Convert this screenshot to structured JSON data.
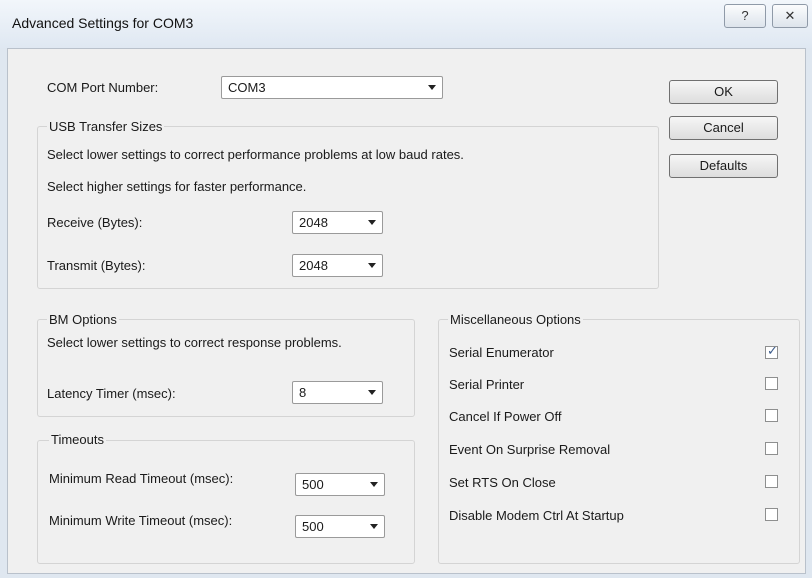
{
  "window": {
    "title": "Advanced Settings for COM3",
    "help_glyph": "?",
    "close_glyph": "✕"
  },
  "com_port": {
    "label": "COM Port Number:",
    "value": "COM3"
  },
  "usb": {
    "title": "USB Transfer Sizes",
    "desc1": "Select lower settings to correct performance problems at low baud rates.",
    "desc2": "Select higher settings for faster performance.",
    "receive_label": "Receive (Bytes):",
    "receive_value": "2048",
    "transmit_label": "Transmit (Bytes):",
    "transmit_value": "2048"
  },
  "bm": {
    "title": "BM Options",
    "desc": "Select lower settings to correct response problems.",
    "latency_label": "Latency Timer (msec):",
    "latency_value": "8"
  },
  "timeouts": {
    "title": "Timeouts",
    "read_label": "Minimum Read Timeout (msec):",
    "read_value": "500",
    "write_label": "Minimum Write Timeout (msec):",
    "write_value": "500"
  },
  "misc": {
    "title": "Miscellaneous Options",
    "items": [
      {
        "label": "Serial Enumerator",
        "checked": true
      },
      {
        "label": "Serial Printer",
        "checked": false
      },
      {
        "label": "Cancel If Power Off",
        "checked": false
      },
      {
        "label": "Event On Surprise Removal",
        "checked": false
      },
      {
        "label": "Set RTS On Close",
        "checked": false
      },
      {
        "label": "Disable Modem Ctrl At Startup",
        "checked": false
      }
    ]
  },
  "buttons": {
    "ok": "OK",
    "cancel": "Cancel",
    "defaults": "Defaults"
  }
}
